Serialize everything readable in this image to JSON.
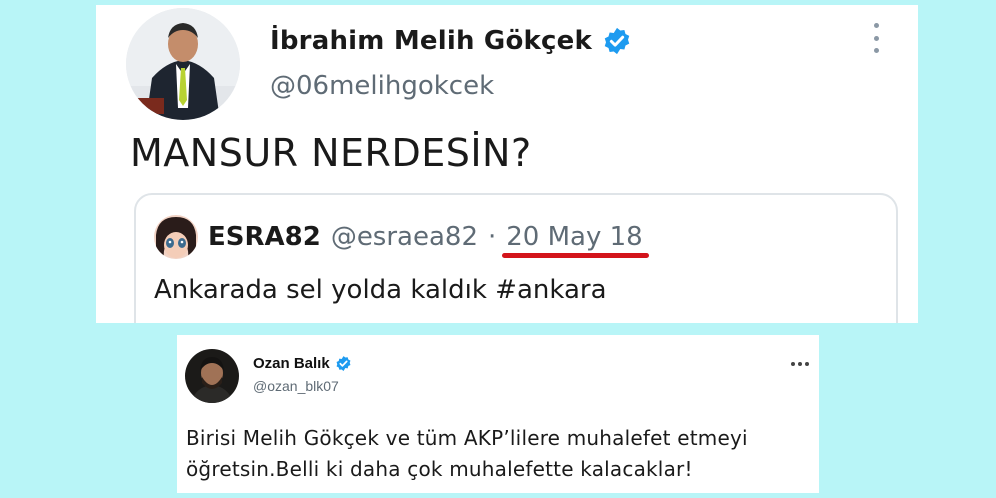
{
  "tweet_main": {
    "author_name": "İbrahim Melih Gökçek",
    "author_handle": "@06melihgokcek",
    "text": "MANSUR NERDESİN?",
    "quoted": {
      "author_name": "ESRA82",
      "author_handle": "@esraea82",
      "separator": "·",
      "date": "20 May 18",
      "text": "Ankarada sel yolda kaldık #ankara"
    }
  },
  "tweet_reply": {
    "author_name": "Ozan Balık",
    "author_handle": "@ozan_blk07",
    "text_line1": "Birisi Melih Gökçek ve tüm AKP’lilere muhalefet etmeyi",
    "text_line2": "öğretsin.Belli ki daha çok muhalefette kalacaklar!"
  },
  "icons": {
    "verified": "verified-badge-icon",
    "more": "more-options-icon"
  },
  "colors": {
    "background": "#b8f5f7",
    "verified_blue": "#1d9bf0",
    "underline_red": "#d3141b",
    "secondary_text": "#5f6b75"
  }
}
